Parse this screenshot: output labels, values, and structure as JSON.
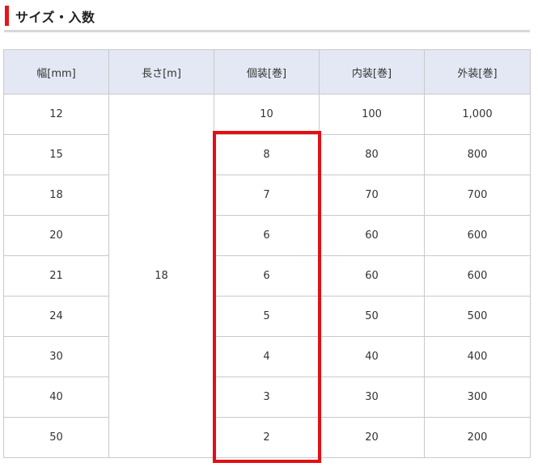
{
  "section": {
    "title": "サイズ・入数"
  },
  "table": {
    "headers": [
      "幅[mm]",
      "長さ[m]",
      "個装[巻]",
      "内装[巻]",
      "外装[巻]"
    ],
    "length_value": "18",
    "rows": [
      {
        "width": "12",
        "individual": "10",
        "inner": "100",
        "outer": "1,000"
      },
      {
        "width": "15",
        "individual": "8",
        "inner": "80",
        "outer": "800"
      },
      {
        "width": "18",
        "individual": "7",
        "inner": "70",
        "outer": "700"
      },
      {
        "width": "20",
        "individual": "6",
        "inner": "60",
        "outer": "600"
      },
      {
        "width": "21",
        "individual": "6",
        "inner": "60",
        "outer": "600"
      },
      {
        "width": "24",
        "individual": "5",
        "inner": "50",
        "outer": "500"
      },
      {
        "width": "30",
        "individual": "4",
        "inner": "40",
        "outer": "400"
      },
      {
        "width": "40",
        "individual": "3",
        "inner": "30",
        "outer": "300"
      },
      {
        "width": "50",
        "individual": "2",
        "inner": "20",
        "outer": "200"
      }
    ]
  },
  "colors": {
    "accent": "#e4151b",
    "header_bg": "#e4e8f4",
    "highlight": "#e30f14"
  }
}
